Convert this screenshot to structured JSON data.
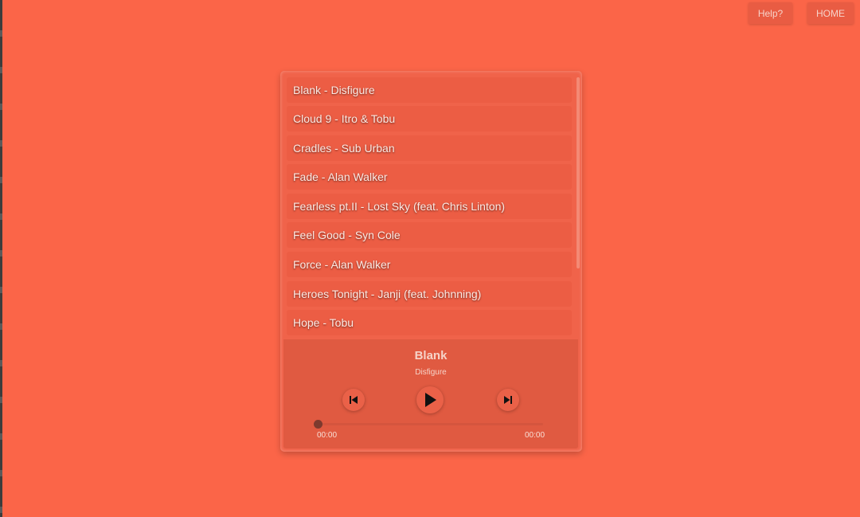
{
  "header": {
    "help_label": "Help?",
    "home_label": "HOME"
  },
  "playlist": {
    "tracks": [
      "Blank - Disfigure",
      "Cloud 9 - Itro & Tobu",
      "Cradles - Sub Urban",
      "Fade - Alan Walker",
      "Fearless pt.II - Lost Sky (feat. Chris Linton)",
      "Feel Good - Syn Cole",
      "Force - Alan Walker",
      "Heroes Tonight - Janji (feat. Johnning)",
      "Hope - Tobu"
    ]
  },
  "now_playing": {
    "title": "Blank",
    "artist": "Disfigure",
    "current_time": "00:00",
    "total_time": "00:00",
    "progress": 0
  },
  "icons": {
    "prev": "skip-previous-icon",
    "play": "play-icon",
    "next": "skip-next-icon"
  },
  "colors": {
    "background": "#fb6548",
    "card": "#f0634a",
    "track": "#ec5d44",
    "controls": "#e05a41"
  }
}
